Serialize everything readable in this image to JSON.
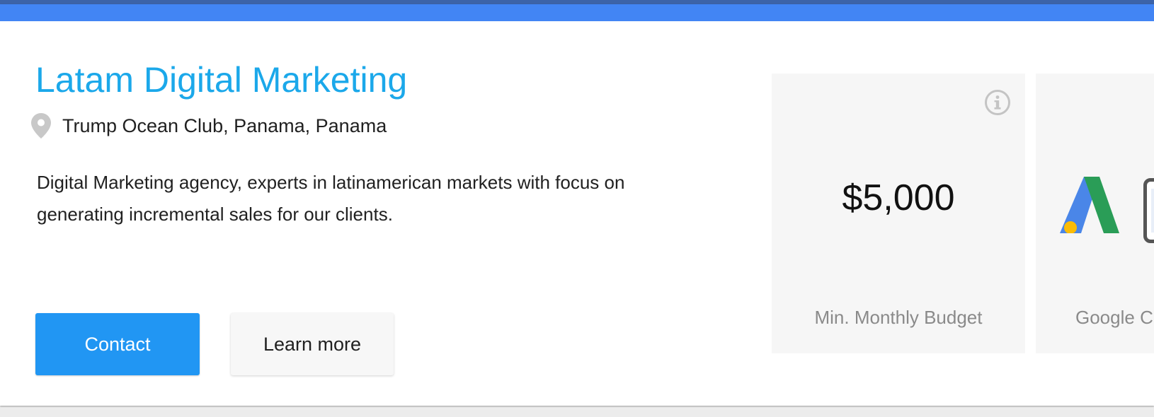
{
  "listing": {
    "title": "Latam Digital Marketing",
    "location": "Trump Ocean Club, Panama, Panama",
    "description": "Digital Marketing agency, experts in latinamerican markets with focus on generating incremental sales for our clients.",
    "contact_label": "Contact",
    "learn_more_label": "Learn more"
  },
  "stats": {
    "budget": {
      "value": "$5,000",
      "label": "Min. Monthly Budget",
      "icon": "info-icon"
    },
    "certification": {
      "label": "Google Ce",
      "icons": [
        "adwords-logo-icon",
        "mobile-device-icon"
      ]
    }
  },
  "colors": {
    "header_bar": "#4285f4",
    "title": "#1ba8ea",
    "contact_button": "#2196f3",
    "tile_background": "#f6f6f6"
  }
}
